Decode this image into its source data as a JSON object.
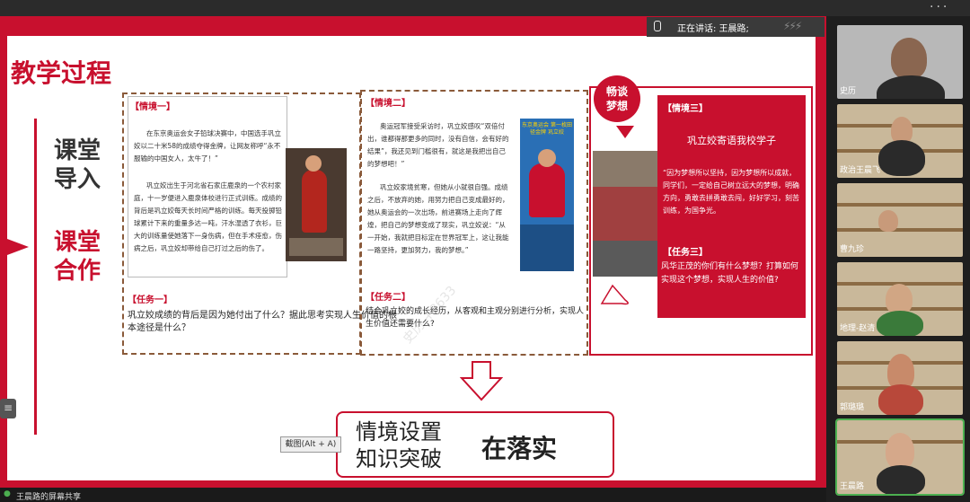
{
  "window": {
    "title": "",
    "top_right": "..."
  },
  "speaker": {
    "label": "正在讲话: 王晨路;",
    "watermark": "⚡⚡⚡"
  },
  "slide": {
    "title": "教学过程",
    "steps": [
      {
        "label": "课堂\n导入"
      },
      {
        "label": "课堂\n合作"
      }
    ],
    "scene1": {
      "label": "【情境一】",
      "paragraph1": "在东京奥运会女子铅球决赛中，中国选手巩立姣以二十米58的成绩夺得金牌，让网友称呼“永不服输的中国女人，太牛了！”",
      "paragraph2": "巩立姣出生于河北省石家庄鹿泉的一个农村家庭，十一岁便进入鹿泉体校进行正式训练。成绩的背后是巩立姣每天长时间严格的训练。每天投掷铅球累计下来的重量多达一吨，汗水湿透了衣衫，巨大的训练量使她落下一身伤病，但在手术痊愈，伤病之后，巩立姣却带给自己打过之后的伤了。",
      "task_label": "【任务一】",
      "task": "巩立姣成绩的背后是因为她付出了什么？据此思考实现人生价值的根本途径是什么？"
    },
    "scene2": {
      "label": "【情境二】",
      "paragraph1": "奥运冠军接受采访时，巩立姣感叹“双倍付出，谁都得那更多的同时，没有自信，会有好的结果”，我还见到门槛很有，就这是我把出自己的梦想吧！”",
      "paragraph2": "巩立姣家境贫寒，但她从小就很自强。成绩之后，不放弃的她，用努力把自己变成最好的，她从奥运会的一次出场，前进赛场上走向了辉煌，把自己的梦想变成了现实，巩立姣说：“从一开始，我就把目标定在世界冠军上，这让我能一路坚持，更加努力，我的梦想。”",
      "task_label": "【任务二】",
      "task": "结合巩立姣的成长经历，从客观和主观分别进行分析，实现人生价值还需要什么?",
      "photo_caption": "东京奥运会 第一枚田径金牌 巩立姣"
    },
    "scene3": {
      "badge": "畅谈\n梦想",
      "label": "【情境三】",
      "heading": "巩立姣寄语我校学子",
      "quote": "“因为梦想所以坚持，因为梦想所以成就，同学们，一定给自己树立远大的梦想，明确方向，勇敢去拼勇敢去闯，好好学习，刻苦训练，为国争光。",
      "task_label": "【任务三】",
      "task": "风华正茂的你们有什么梦想？打算如何实现这个梦想，实现人生的价值?"
    },
    "summary": {
      "line1": "情境设置",
      "line2": "知识突破",
      "emphasis": "在落实"
    },
    "screenshot_tip": "截图(Alt + A)",
    "watermark": "史历 +8633"
  },
  "bottom": {
    "share_label": "王晨路的屏幕共享"
  },
  "participants": [
    {
      "name": "史历"
    },
    {
      "name": "政治王晨飞"
    },
    {
      "name": "曹九珍"
    },
    {
      "name": "地理-赵清"
    },
    {
      "name": "郭璐璐"
    },
    {
      "name": "王晨路"
    }
  ],
  "colors": {
    "accent": "#c8102e",
    "dash": "#8a5a3a",
    "active": "#4caf50"
  }
}
